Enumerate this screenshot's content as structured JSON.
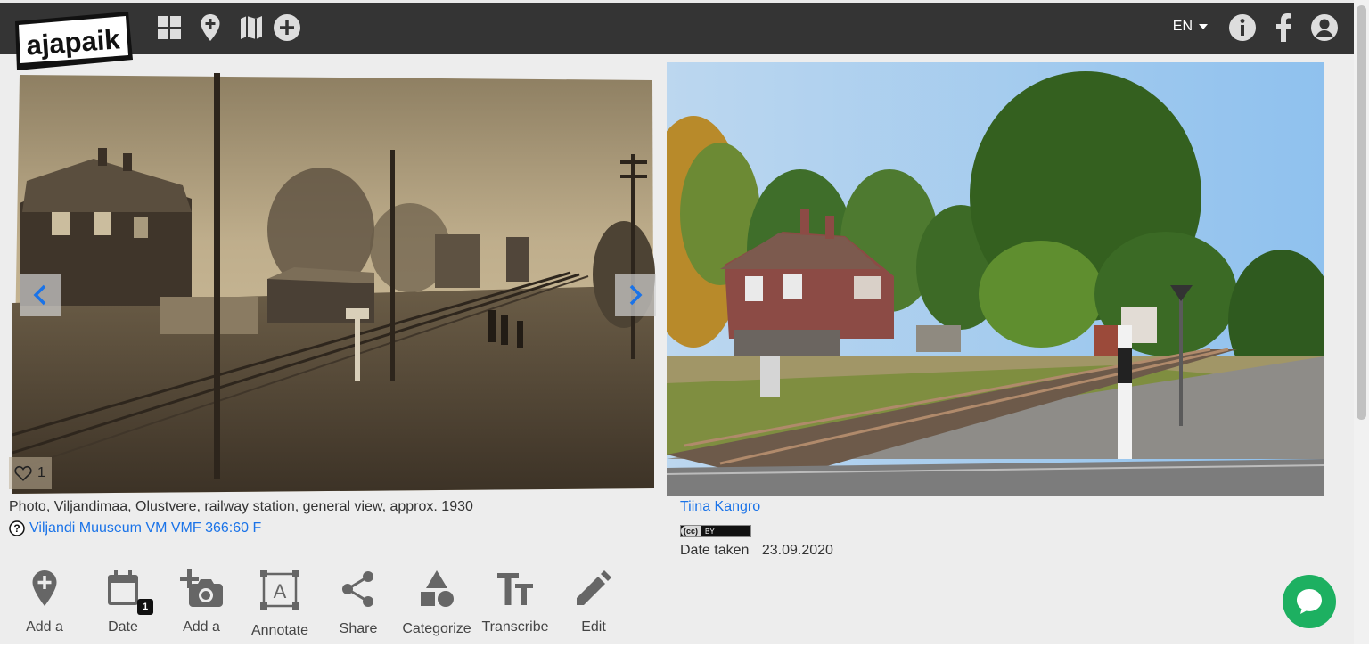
{
  "app": {
    "logo_text": "ajapaik",
    "language": "EN"
  },
  "nav": {
    "left_icons": [
      "grid-icon",
      "map-pin-icon",
      "map-icon",
      "plus-circle-icon"
    ],
    "right_icons": [
      "info-icon",
      "facebook-icon",
      "user-icon"
    ]
  },
  "photo": {
    "caption": "Photo, Viljandimaa, Olustvere, railway station, general view, approx. 1930",
    "source": "Viljandi Muuseum VM VMF 366:60 F",
    "likes": "1"
  },
  "rephoto": {
    "author": "Tiina Kangro",
    "license_cc": "(cc)",
    "license_by": "BY",
    "date_label": "Date taken",
    "date_value": "23.09.2020"
  },
  "toolbar": {
    "items": [
      {
        "label": "Add a",
        "icon": "add-location-icon"
      },
      {
        "label": "Date",
        "icon": "calendar-icon",
        "badge": "1"
      },
      {
        "label": "Add a",
        "icon": "add-camera-icon"
      },
      {
        "label": "Annotate",
        "icon": "annotate-icon"
      },
      {
        "label": "Share",
        "icon": "share-icon"
      },
      {
        "label": "Categorize",
        "icon": "shapes-icon"
      },
      {
        "label": "Transcribe",
        "icon": "text-icon"
      },
      {
        "label": "Edit",
        "icon": "pencil-icon"
      }
    ]
  },
  "colors": {
    "navbar": "#343434",
    "link": "#1a73e8",
    "chat": "#1db061",
    "background": "#ededed",
    "arrow": "#1a73e8"
  }
}
